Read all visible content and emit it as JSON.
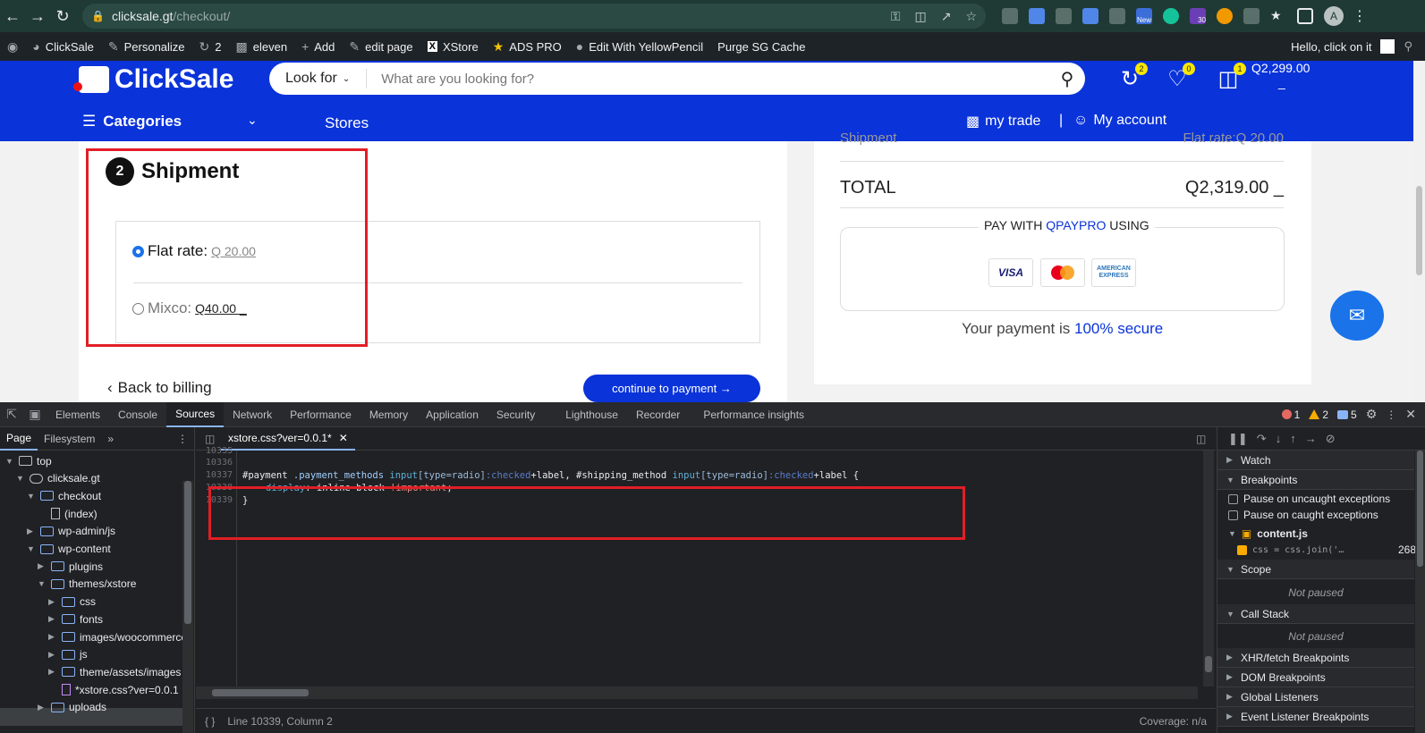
{
  "browser": {
    "url_host": "clicksale.gt",
    "url_path": "/checkout/",
    "avatar_letter": "A",
    "ext_badge": "New",
    "ext_count": "30"
  },
  "wp_bar": {
    "site": "ClickSale",
    "personalize": "Personalize",
    "updates_count": "2",
    "comments": "eleven",
    "add": "Add",
    "edit_page": "edit page",
    "xstore": "XStore",
    "ads_pro": "ADS PRO",
    "yellowpencil": "Edit With YellowPencil",
    "purge": "Purge SG Cache",
    "greeting": "Hello, click on it"
  },
  "header": {
    "logo": "ClickSale",
    "look_for": "Look for",
    "search_placeholder": "What are you looking for?",
    "compare_count": "2",
    "wishlist_count": "0",
    "cart_count": "1",
    "cart_total": "Q2,299.00",
    "cart_total_suffix": "_",
    "categories": "Categories",
    "stores": "Stores",
    "my_trade": "my trade",
    "separator": "|",
    "my_account": "My account"
  },
  "shipment": {
    "step": "2",
    "title": "Shipment",
    "options": [
      {
        "label": "Flat rate:",
        "price": "Q 20.00",
        "selected": true
      },
      {
        "label": "Mixco:",
        "price": "Q40.00 _",
        "selected": false
      }
    ],
    "back": "Back to billing",
    "continue": "continue to payment →"
  },
  "summary": {
    "cut_label": "Shipment",
    "cut_value": "Flat rate:Q 20.00",
    "total_label": "TOTAL",
    "total_value": "Q2,319.00 _",
    "pay_with": "PAY WITH",
    "pay_brand": "QPAYPRO",
    "pay_using": "USING",
    "cards": [
      "VISA",
      "mastercard",
      "AMERICAN EXPRESS"
    ],
    "secure_prefix": "Your payment is",
    "secure_hl": "100% secure"
  },
  "devtools": {
    "tabs": [
      "Elements",
      "Console",
      "Sources",
      "Network",
      "Performance",
      "Memory",
      "Application",
      "Security",
      "Lighthouse",
      "Recorder",
      "Performance insights"
    ],
    "active_tab": "Sources",
    "errors": "1",
    "warnings": "2",
    "messages": "5",
    "nav_tabs": [
      "Page",
      "Filesystem"
    ],
    "tree": [
      {
        "label": "top",
        "indent": 0,
        "kind": "frame",
        "open": true
      },
      {
        "label": "clicksale.gt",
        "indent": 1,
        "kind": "cloud",
        "open": true
      },
      {
        "label": "checkout",
        "indent": 2,
        "kind": "folder",
        "open": true
      },
      {
        "label": "(index)",
        "indent": 3,
        "kind": "file",
        "open": false
      },
      {
        "label": "wp-admin/js",
        "indent": 2,
        "kind": "folder",
        "open": false
      },
      {
        "label": "wp-content",
        "indent": 2,
        "kind": "folder",
        "open": true
      },
      {
        "label": "plugins",
        "indent": 3,
        "kind": "folder",
        "open": false
      },
      {
        "label": "themes/xstore",
        "indent": 3,
        "kind": "folder",
        "open": true
      },
      {
        "label": "css",
        "indent": 4,
        "kind": "folder",
        "open": false
      },
      {
        "label": "fonts",
        "indent": 4,
        "kind": "folder",
        "open": false
      },
      {
        "label": "images/woocommerce",
        "indent": 4,
        "kind": "folder",
        "open": false
      },
      {
        "label": "js",
        "indent": 4,
        "kind": "folder",
        "open": false
      },
      {
        "label": "theme/assets/images",
        "indent": 4,
        "kind": "folder",
        "open": false
      },
      {
        "label": "*xstore.css?ver=0.0.1",
        "indent": 4,
        "kind": "cssfile",
        "open": false
      },
      {
        "label": "uploads",
        "indent": 3,
        "kind": "folder",
        "open": false
      }
    ],
    "file_tab": "xstore.css?ver=0.0.1*",
    "line_numbers": [
      "10335",
      "10336",
      "10337",
      "10338",
      "10339"
    ],
    "code_line_1": {
      "s1": "#payment",
      "s2": ".payment_methods",
      "s3": "input",
      "s4": "[type=radio]",
      "s5": ":checked",
      "s6": "+label, ",
      "s7": "#shipping_method",
      "s8": "input",
      "s9": "[type=radio]",
      "s10": ":checked",
      "s11": "+label {"
    },
    "code_line_2": {
      "prop": "display",
      "value": "inline-block",
      "imp": "!important"
    },
    "code_line_3": "}",
    "status_position": "Line 10339, Column 2",
    "coverage": "Coverage: n/a",
    "watch": "Watch",
    "breakpoints": "Breakpoints",
    "pause_uncaught": "Pause on uncaught exceptions",
    "pause_caught": "Pause on caught exceptions",
    "bp_file": "content.js",
    "bp_code": "css = css.join('…",
    "bp_line": "268",
    "scope": "Scope",
    "not_paused": "Not paused",
    "call_stack": "Call Stack",
    "xhr": "XHR/fetch Breakpoints",
    "dom": "DOM Breakpoints",
    "global": "Global Listeners",
    "event": "Event Listener Breakpoints"
  }
}
